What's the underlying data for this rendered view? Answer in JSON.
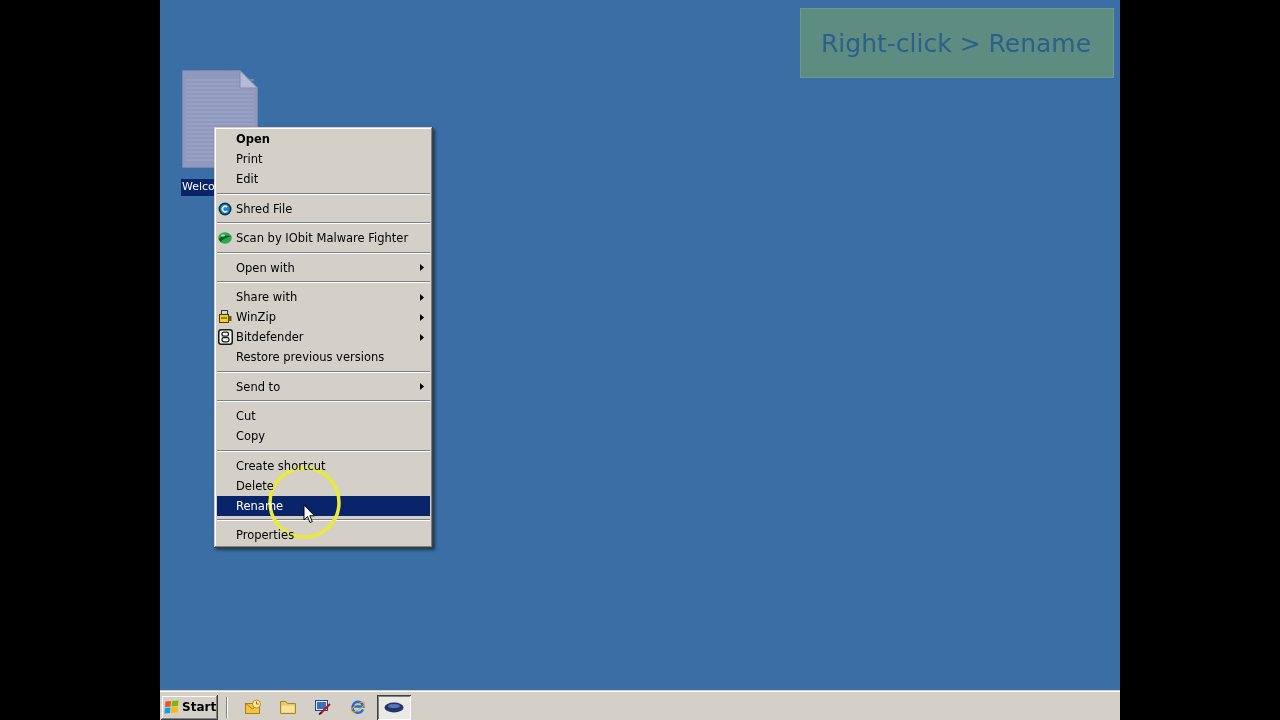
{
  "caption": {
    "text": "Right-click > Rename"
  },
  "desktop_icons": [
    {
      "label": "Welco",
      "selected": true
    }
  ],
  "context_menu": {
    "groups": [
      [
        {
          "label": "Open",
          "default": true,
          "submenu": false,
          "selected": false
        },
        {
          "label": "Print",
          "default": false,
          "submenu": false,
          "selected": false
        },
        {
          "label": "Edit",
          "default": false,
          "submenu": false,
          "selected": false
        }
      ],
      [
        {
          "label": "Shred File",
          "default": false,
          "submenu": false,
          "selected": false
        }
      ],
      [
        {
          "label": "Scan by IObit Malware Fighter",
          "default": false,
          "submenu": false,
          "selected": false
        }
      ],
      [
        {
          "label": "Open with",
          "default": false,
          "submenu": true,
          "selected": false
        }
      ],
      [
        {
          "label": "Share with",
          "default": false,
          "submenu": true,
          "selected": false
        },
        {
          "label": "WinZip",
          "default": false,
          "submenu": true,
          "selected": false
        },
        {
          "label": "Bitdefender",
          "default": false,
          "submenu": true,
          "selected": false
        },
        {
          "label": "Restore previous versions",
          "default": false,
          "submenu": false,
          "selected": false
        }
      ],
      [
        {
          "label": "Send to",
          "default": false,
          "submenu": true,
          "selected": false
        }
      ],
      [
        {
          "label": "Cut",
          "default": false,
          "submenu": false,
          "selected": false
        },
        {
          "label": "Copy",
          "default": false,
          "submenu": false,
          "selected": false
        }
      ],
      [
        {
          "label": "Create shortcut",
          "default": false,
          "submenu": false,
          "selected": false
        },
        {
          "label": "Delete",
          "default": false,
          "submenu": false,
          "selected": false
        },
        {
          "label": "Rename",
          "default": false,
          "submenu": false,
          "selected": true
        }
      ],
      [
        {
          "label": "Properties",
          "default": false,
          "submenu": false,
          "selected": false
        }
      ]
    ]
  },
  "taskbar": {
    "start_button": {
      "label": "Start"
    },
    "task_buttons": [
      {
        "selected": true
      }
    ]
  }
}
